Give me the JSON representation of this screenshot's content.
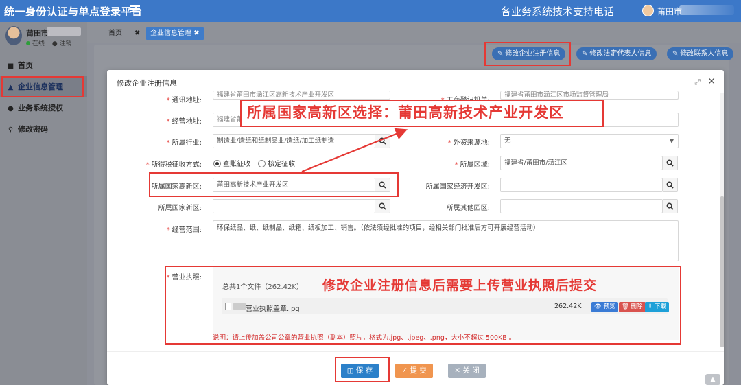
{
  "app": {
    "title": "统一身份认证与单点登录平台",
    "phone_link": "各业务系统技术支持电话",
    "user_name": "莆田市"
  },
  "sidebar": {
    "profile_name": "莆田市",
    "status_online": "在线",
    "status_logout": "注销",
    "items": [
      {
        "label": "首页",
        "icon": "home-icon"
      },
      {
        "label": "企业信息管理",
        "icon": "bank-icon"
      },
      {
        "label": "业务系统授权",
        "icon": "users-icon"
      },
      {
        "label": "修改密码",
        "icon": "key-icon"
      }
    ]
  },
  "tabs": {
    "home": "首页",
    "active": "企业信息管理"
  },
  "actions": {
    "edit_registration": "修改企业注册信息",
    "edit_legal_rep": "修改法定代表人信息",
    "edit_contact": "修改联系人信息"
  },
  "modal": {
    "title": "修改企业注册信息",
    "fields": {
      "address_label": "通讯地址:",
      "address_value": "福建省莆田市涵江区高新技术产业开发区",
      "business_reg_label": "工商登记机关:",
      "business_reg_value": "福建省莆田市涵江区市场监督管理局",
      "biz_address_label": "经营地址:",
      "biz_address_value": "福建省莆田市涵江区高新技术产业开发区",
      "industry_label": "所属行业:",
      "industry_value": "制造业/造纸和纸制品业/造纸/加工纸制造",
      "foreign_label": "外资来源地:",
      "foreign_value": "无",
      "tax_label": "所得税征收方式:",
      "tax_opt1": "查账征收",
      "tax_opt2": "核定征收",
      "region_label": "所属区域:",
      "region_value": "福建省/莆田市/涵江区",
      "hitech_label": "所属国家高新区:",
      "hitech_value": "莆田高新技术产业开发区",
      "econ_label": "所属国家经济开发区:",
      "econ_value": "",
      "newarea_label": "所属国家新区:",
      "newarea_value": "",
      "otherpark_label": "所属其他园区:",
      "otherpark_value": "",
      "scope_label": "经营范围:",
      "scope_value": "环保纸品、纸、纸制品、纸箱、纸板加工、销售。（依法须经批准的项目，经相关部门批准后方可开展经营活动）",
      "license_label": "营业执照:"
    },
    "upload": {
      "count": "总共1个文件（262.42K）",
      "file_name": "营业执照盖章.jpg",
      "file_size": "262.42K",
      "btn_preview": "预览",
      "btn_delete": "删除",
      "btn_download": "下载",
      "note": "说明：请上传加盖公司公章的营业执照（副本）照片，格式为.jpg、.jpeg、.png，大小不超过 500KB 。"
    },
    "buttons": {
      "save": "保 存",
      "submit": "提 交",
      "close": "关 闭"
    }
  },
  "annotations": {
    "hitech_hint": "所属国家高新区选择：莆田高新技术产业开发区",
    "upload_hint": "修改企业注册信息后需要上传营业执照后提交",
    "color": "#e53935"
  }
}
